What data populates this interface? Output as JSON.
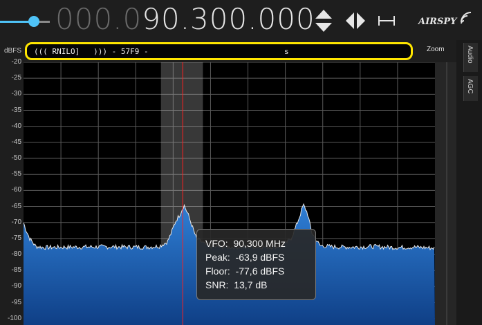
{
  "header": {
    "frequency_dim": "000.0",
    "frequency_bright": "90.300.000",
    "logo_text": "AIRSPY"
  },
  "icons": {
    "updown": "up-down-arrows-icon",
    "leftright": "left-right-arrows-icon",
    "span": "span-width-icon",
    "logo_waves": "radio-waves-icon"
  },
  "rds": {
    "text": "((( RNILO]   ))) - 57F9 -",
    "trailing": "s"
  },
  "labels": {
    "dbfs_unit": "dBFS",
    "zoom": "Zoom",
    "tab_audio": "Audio",
    "tab_agc": "AGC"
  },
  "tooltip": {
    "vfo": "VFO:  90,300 MHz",
    "peak": "Peak:  -63,9 dBFS",
    "floor": "Floor:  -77,6 dBFS",
    "snr": "SNR:  13,7 dB"
  },
  "colors": {
    "accent_yellow": "#ffe600",
    "spectrum_blue": "#1f66b8",
    "vfo_line": "#ff2020",
    "slider": "#4fc3f7"
  },
  "chart_data": {
    "type": "area",
    "y_ticks": [
      "-20",
      "-25",
      "-30",
      "-35",
      "-40",
      "-45",
      "-50",
      "-55",
      "-60",
      "-65",
      "-70",
      "-75",
      "-80",
      "-85",
      "-90",
      "-95",
      "-100"
    ],
    "ylim": [
      -102,
      -20
    ],
    "xlim": [
      0,
      100
    ],
    "grid": true,
    "series": [
      {
        "x": [
          0,
          0.5,
          1.5,
          3,
          5,
          10,
          20,
          30,
          33,
          35,
          36,
          37,
          38,
          39,
          40,
          42,
          45,
          50,
          55,
          60,
          63,
          65,
          66,
          67,
          68,
          69,
          70,
          72,
          75,
          80,
          85,
          90,
          95,
          100
        ],
        "values": [
          -70,
          -72,
          -75,
          -77.5,
          -77.8,
          -77.7,
          -77.6,
          -77.7,
          -77.4,
          -76,
          -73,
          -69.5,
          -67.5,
          -64.5,
          -67.5,
          -75,
          -77.5,
          -77.7,
          -77.6,
          -77.6,
          -77.4,
          -75,
          -72,
          -68.5,
          -64.5,
          -67,
          -73,
          -77.2,
          -77.6,
          -77.7,
          -77.5,
          -77.8,
          -77.7,
          -78
        ]
      }
    ],
    "vfo_band": [
      33.4,
      43.6
    ],
    "vfo_center": 38.7
  }
}
